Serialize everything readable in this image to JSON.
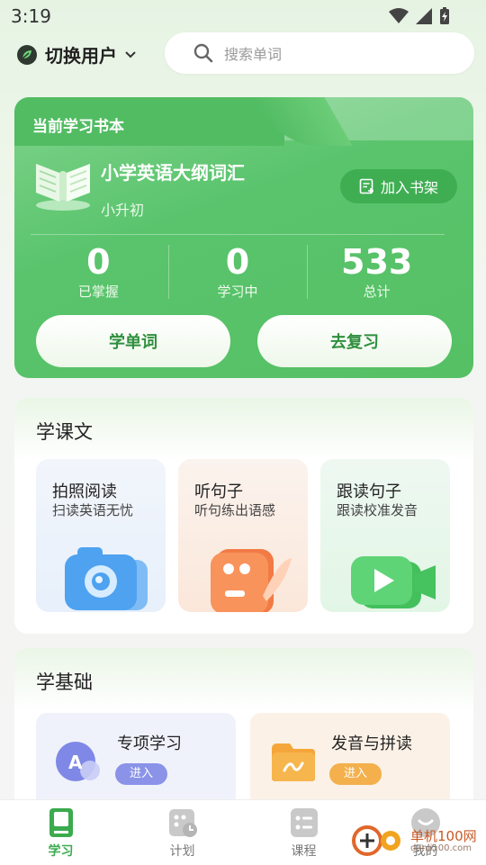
{
  "status_bar": {
    "time": "3:19"
  },
  "header": {
    "user_switch_label": "切换用户",
    "search_placeholder": "搜索单词"
  },
  "book_card": {
    "label": "当前学习书本",
    "book_title": "小学英语大纲词汇",
    "book_subtitle": "小升初",
    "add_to_shelf": "加入书架",
    "stats": [
      {
        "value": "0",
        "label": "已掌握"
      },
      {
        "value": "0",
        "label": "学习中"
      },
      {
        "value": "533",
        "label": "总计"
      }
    ],
    "learn_button": "学单词",
    "review_button": "去复习"
  },
  "text_section": {
    "title": "学课文",
    "tiles": [
      {
        "title": "拍照阅读",
        "subtitle": "扫读英语无忧",
        "icon": "camera-icon"
      },
      {
        "title": "听句子",
        "subtitle": "听句练出语感",
        "icon": "quote-feather-icon"
      },
      {
        "title": "跟读句子",
        "subtitle": "跟读校准发音",
        "icon": "video-camera-icon"
      }
    ]
  },
  "basics_section": {
    "title": "学基础",
    "cards": [
      {
        "title": "专项学习",
        "button": "进入",
        "icon": "letter-a-icon"
      },
      {
        "title": "发音与拼读",
        "button": "进入",
        "icon": "folder-wave-icon"
      }
    ]
  },
  "bottom_nav": {
    "items": [
      {
        "label": "学习",
        "icon": "book-icon",
        "active": true
      },
      {
        "label": "计划",
        "icon": "calendar-clock-icon",
        "active": false
      },
      {
        "label": "课程",
        "icon": "list-icon",
        "active": false
      },
      {
        "label": "我的",
        "icon": "profile-icon",
        "active": false
      }
    ]
  },
  "watermark": {
    "text": "单机100网",
    "url": "danji100.com"
  },
  "colors": {
    "accent": "#55c064",
    "accent_dark": "#3fae52"
  }
}
